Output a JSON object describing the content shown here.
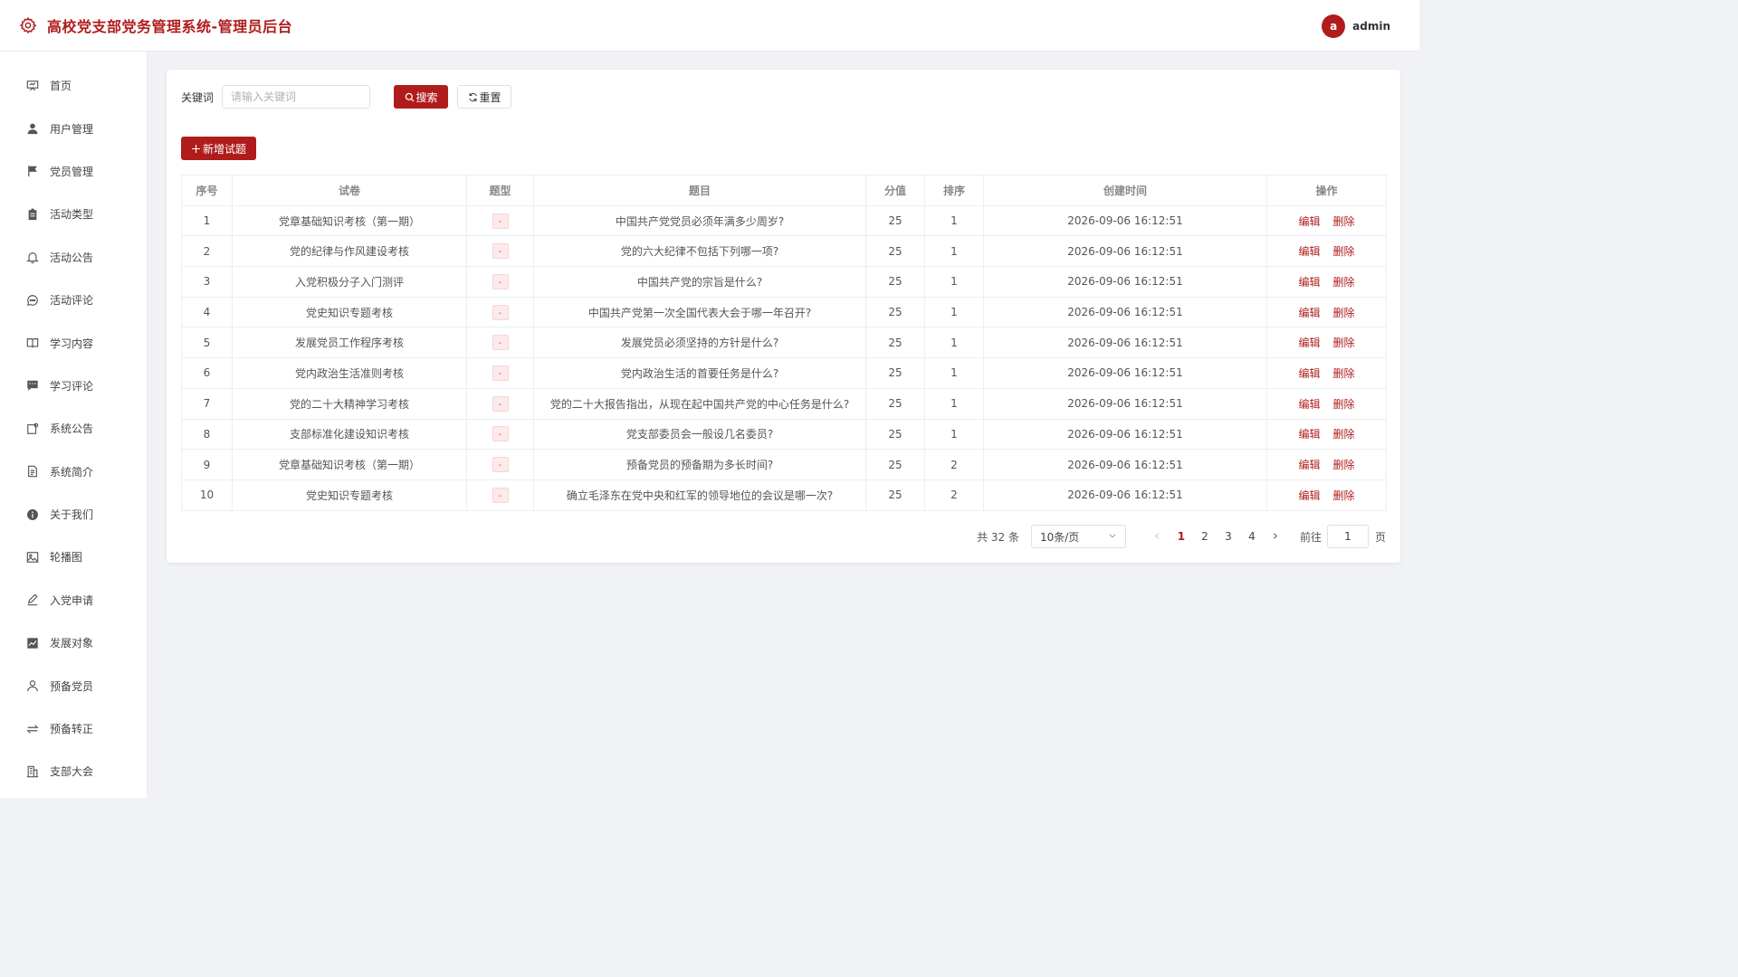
{
  "header": {
    "title": "高校党支部党务管理系统-管理员后台",
    "avatar_letter": "a",
    "username": "admin",
    "brand_color": "#b01c1c"
  },
  "sidebar": {
    "items": [
      {
        "label": "首页",
        "icon": "presentation-icon"
      },
      {
        "label": "用户管理",
        "icon": "user-icon"
      },
      {
        "label": "党员管理",
        "icon": "flag-icon"
      },
      {
        "label": "活动类型",
        "icon": "clipboard-icon"
      },
      {
        "label": "活动公告",
        "icon": "bell-icon"
      },
      {
        "label": "活动评论",
        "icon": "chat-icon"
      },
      {
        "label": "学习内容",
        "icon": "book-icon"
      },
      {
        "label": "学习评论",
        "icon": "message-icon"
      },
      {
        "label": "系统公告",
        "icon": "notice-icon"
      },
      {
        "label": "系统简介",
        "icon": "document-icon"
      },
      {
        "label": "关于我们",
        "icon": "info-icon"
      },
      {
        "label": "轮播图",
        "icon": "picture-icon"
      },
      {
        "label": "入党申请",
        "icon": "pen-icon"
      },
      {
        "label": "发展对象",
        "icon": "chart-icon"
      },
      {
        "label": "预备党员",
        "icon": "person-icon"
      },
      {
        "label": "预备转正",
        "icon": "switch-icon"
      },
      {
        "label": "支部大会",
        "icon": "building-icon"
      }
    ]
  },
  "search": {
    "label": "关键词",
    "placeholder": "请输入关键词",
    "search_label": "搜索",
    "reset_label": "重置"
  },
  "add_label": "新增试题",
  "table": {
    "headers": [
      "序号",
      "试卷",
      "题型",
      "题目",
      "分值",
      "排序",
      "创建时间",
      "操作"
    ],
    "edit_label": "编辑",
    "delete_label": "删除",
    "rows": [
      {
        "no": "1",
        "paper": "党章基础知识考核（第一期）",
        "type": "-",
        "question": "中国共产党党员必须年满多少周岁?",
        "score": "25",
        "sort": "1",
        "time": "2026-09-06 16:12:51"
      },
      {
        "no": "2",
        "paper": "党的纪律与作风建设考核",
        "type": "-",
        "question": "党的六大纪律不包括下列哪一项?",
        "score": "25",
        "sort": "1",
        "time": "2026-09-06 16:12:51"
      },
      {
        "no": "3",
        "paper": "入党积极分子入门测评",
        "type": "-",
        "question": "中国共产党的宗旨是什么?",
        "score": "25",
        "sort": "1",
        "time": "2026-09-06 16:12:51"
      },
      {
        "no": "4",
        "paper": "党史知识专题考核",
        "type": "-",
        "question": "中国共产党第一次全国代表大会于哪一年召开?",
        "score": "25",
        "sort": "1",
        "time": "2026-09-06 16:12:51"
      },
      {
        "no": "5",
        "paper": "发展党员工作程序考核",
        "type": "-",
        "question": "发展党员必须坚持的方针是什么?",
        "score": "25",
        "sort": "1",
        "time": "2026-09-06 16:12:51"
      },
      {
        "no": "6",
        "paper": "党内政治生活准则考核",
        "type": "-",
        "question": "党内政治生活的首要任务是什么?",
        "score": "25",
        "sort": "1",
        "time": "2026-09-06 16:12:51"
      },
      {
        "no": "7",
        "paper": "党的二十大精神学习考核",
        "type": "-",
        "question": "党的二十大报告指出，从现在起中国共产党的中心任务是什么?",
        "score": "25",
        "sort": "1",
        "time": "2026-09-06 16:12:51"
      },
      {
        "no": "8",
        "paper": "支部标准化建设知识考核",
        "type": "-",
        "question": "党支部委员会一般设几名委员?",
        "score": "25",
        "sort": "1",
        "time": "2026-09-06 16:12:51"
      },
      {
        "no": "9",
        "paper": "党章基础知识考核（第一期）",
        "type": "-",
        "question": "预备党员的预备期为多长时间?",
        "score": "25",
        "sort": "2",
        "time": "2026-09-06 16:12:51"
      },
      {
        "no": "10",
        "paper": "党史知识专题考核",
        "type": "-",
        "question": "确立毛泽东在党中央和红军的领导地位的会议是哪一次?",
        "score": "25",
        "sort": "2",
        "time": "2026-09-06 16:12:51"
      }
    ]
  },
  "pagination": {
    "total": "共 32 条",
    "page_size": "10条/页",
    "pages": [
      "1",
      "2",
      "3",
      "4"
    ],
    "current": "1",
    "goto_label": "前往",
    "goto_value": "1",
    "page_suffix": "页"
  }
}
